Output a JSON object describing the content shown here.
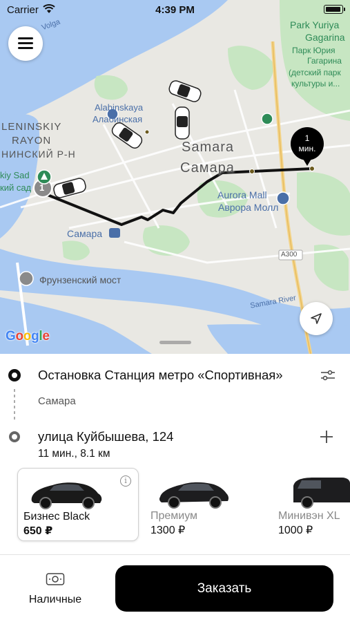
{
  "status_bar": {
    "carrier": "Carrier",
    "time": "4:39 PM"
  },
  "map": {
    "labels": {
      "volga": "Volga",
      "park_en_1": "Park Yuriya",
      "park_en_2": "Gagarina",
      "park_ru_1": "Парк Юрия",
      "park_ru_2": "Гагарина",
      "park_ru_3": "(детский парк",
      "park_ru_4": "культуры и...",
      "alabinskaya_en": "Alabinskaya",
      "alabinskaya_ru": "Алабинская",
      "leninskiy_en_1": "LENINSKIY",
      "leninskiy_en_2": "RAYON",
      "leninskiy_ru": "НИНСКИЙ Р-Н",
      "city_en": "Samara",
      "city_ru": "Самара",
      "sad_en": "kiy Sad",
      "sad_ru": "кий сад",
      "aurora_en": "Aurora Mall",
      "aurora_ru": "Аврора Молл",
      "station": "Самара",
      "road": "A300",
      "bridge": "Фрунзенский мост",
      "river": "Samara River"
    },
    "start_pin_label": "1",
    "eta_pin": {
      "value": "1",
      "unit": "мин."
    },
    "brand": {
      "g1": "G",
      "o1": "o",
      "o2": "o",
      "g2": "g",
      "l": "l",
      "e": "e"
    }
  },
  "route": {
    "origin": "Остановка Станция метро «Спортивная»",
    "origin_city": "Самара",
    "destination": "улица Куйбышева, 124",
    "trip_info": "11 мин., 8.1 км"
  },
  "tariffs": [
    {
      "name": "Бизнес Black",
      "price": "650 ₽",
      "selected": true
    },
    {
      "name": "Премиум",
      "price": "1300 ₽",
      "selected": false
    },
    {
      "name": "Минивэн XL",
      "price": "1000 ₽",
      "selected": false
    }
  ],
  "tariff_info_glyph": "i",
  "payment": {
    "label": "Наличные"
  },
  "order_button": {
    "label": "Заказать"
  },
  "colors": {
    "water": "#a9c9f2",
    "park": "#c7e6c2",
    "land": "#e9e8e3",
    "route": "#111111",
    "label_blue": "#4a6fa8",
    "label_green": "#2e8b57"
  }
}
